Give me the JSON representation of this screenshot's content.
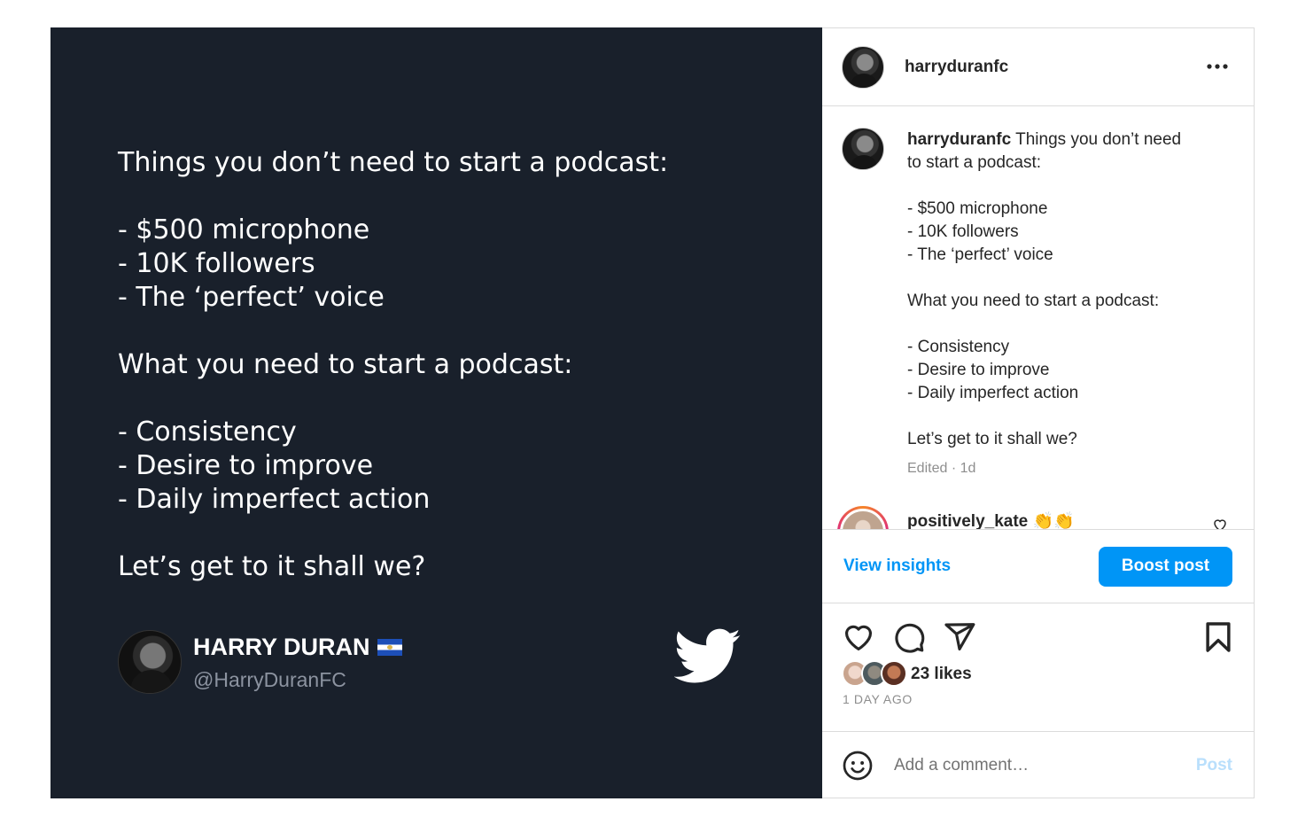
{
  "image_post": {
    "lines": [
      "Things you don’t need to start a podcast:",
      "",
      "- $500 microphone",
      "- 10K followers",
      "- The ‘perfect’ voice",
      "",
      "What you need to start a podcast:",
      "",
      "- Consistency",
      "- Desire to improve",
      "- Daily imperfect action",
      "",
      "Let’s get to it shall we?"
    ],
    "author_name": "HARRY DURAN",
    "author_handle": "@HarryDuranFC",
    "background_color": "#19202b",
    "icons": [
      "el-salvador-flag",
      "twitter-bird-icon"
    ]
  },
  "header": {
    "username": "harryduranfc",
    "icons": [
      "avatar",
      "more-options-icon"
    ]
  },
  "caption": {
    "username": "harryduranfc",
    "first_line": " Things you don’t need",
    "lines": [
      "to start a podcast:",
      "",
      "- $500 microphone",
      "- 10K followers",
      "- The ‘perfect’ voice",
      "",
      "What you need to start a podcast:",
      "",
      "- Consistency",
      "- Desire to improve",
      "- Daily imperfect action",
      "",
      "Let’s get to it shall we?"
    ],
    "meta": "Edited · 1d"
  },
  "first_comment": {
    "username": "positively_kate",
    "emoji": "👏👏"
  },
  "insights": {
    "view_label": "View insights",
    "boost_label": "Boost post",
    "accent_color": "#0095f6"
  },
  "actions": {
    "icons": [
      "heart-icon",
      "comment-icon",
      "share-icon",
      "bookmark-icon"
    ]
  },
  "likes": {
    "count_label": "23 likes",
    "age": "1 DAY AGO"
  },
  "comment_box": {
    "placeholder": "Add a comment…",
    "post_label": "Post",
    "icons": [
      "emoji-icon"
    ]
  }
}
